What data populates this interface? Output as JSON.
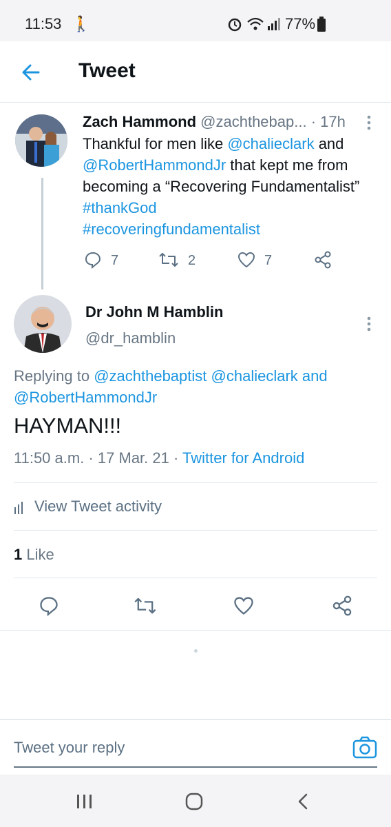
{
  "status_bar": {
    "time": "11:53",
    "battery": "77%"
  },
  "header": {
    "title": "Tweet"
  },
  "parent_tweet": {
    "name": "Zach Hammond",
    "handle": "@zachthebap...",
    "separator": "·",
    "time": "17h",
    "text_parts": [
      "Thankful for men like ",
      "@chalieclark",
      " and ",
      "@RobertHammondJr",
      " that kept me from becoming a “Recovering Fundamentalist” ",
      "#thankGod",
      "#recoveringfundamentalist"
    ],
    "replies": "7",
    "retweets": "2",
    "likes": "7"
  },
  "main_tweet": {
    "name": "Dr John M Hamblin",
    "handle": "@dr_hamblin",
    "replying_label": "Replying to ",
    "replying_to_1": "@zachthebaptist",
    "replying_to_2": "@chalieclark",
    "replying_and": " and",
    "replying_to_3": "@RobertHammondJr",
    "text": "HAYMAN!!!",
    "time": "11:50 a.m.",
    "date": "17 Mar. 21",
    "sep": "·",
    "source": "Twitter for Android",
    "activity": "View Tweet activity",
    "like_count": "1",
    "like_label": "Like"
  },
  "reply_bar": {
    "placeholder": "Tweet your reply"
  },
  "colors": {
    "link": "#1b95e0",
    "muted": "#687684"
  }
}
